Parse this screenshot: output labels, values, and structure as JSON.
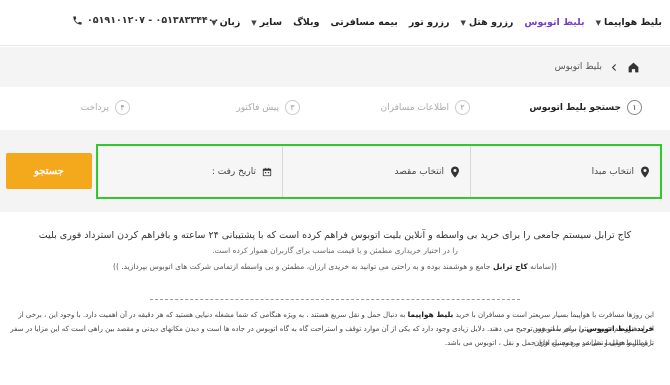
{
  "nav": {
    "items": [
      {
        "label": "بلیط هواپیما",
        "caret": true,
        "active": false
      },
      {
        "label": "بلیط اتوبوس",
        "caret": false,
        "active": true
      },
      {
        "label": "رزرو هتل",
        "caret": true,
        "active": false
      },
      {
        "label": "رزرو تور",
        "caret": false,
        "active": false
      },
      {
        "label": "بیمه مسافرتی",
        "caret": false,
        "active": false
      },
      {
        "label": "وبلاگ",
        "caret": false,
        "active": false
      },
      {
        "label": "سایر",
        "caret": true,
        "active": false
      },
      {
        "label": "زبان",
        "caret": true,
        "active": false
      }
    ],
    "phone": "۰۵۱۹۱۰۱۲۰۷ - ۰۵۱۳۸۳۳۴۴۰۰",
    "accent": "#7a3fc4"
  },
  "breadcrumb": {
    "current": "بلیط اتوبوس",
    "home_icon": "home-icon",
    "separator": "chevron-left-icon"
  },
  "steps": [
    {
      "num": "۱",
      "label": "جستجو بلیط اتوبوس",
      "active": true
    },
    {
      "num": "۲",
      "label": "اطلاعات مسافران",
      "active": false
    },
    {
      "num": "۳",
      "label": "پیش فاکتور",
      "active": false
    },
    {
      "num": "۴",
      "label": "پرداخت",
      "active": false
    }
  ],
  "search": {
    "origin": "انتخاب مبدا",
    "destination": "انتخاب مقصد",
    "date": "تاریخ رفت :",
    "button": "جستجو",
    "button_color": "#f4a81c",
    "highlight_color": "#2ec92a"
  },
  "content": {
    "line1": "کاج ترابل سیستم جامعی را برای خرید بی واسطه و آنلاین بلیت اتوبوس فراهم کرده است که با پشتیبانی ۲۴ ساعته و بافراهم کردن استرداد فوری بلیت",
    "line2": "را در اختیار خریداری مطمئن و با قیمت مناسب برای گاربران هموار کرده است.",
    "line3_pre": "((سامانه",
    "line3_bold": "کاج ترابل",
    "line3_post": "جامع و هوشمند بوده و به راحتی می توانید به خریدی ارزان، مطمئن و بی واسطه ازتمامی شرکت های اتوبوس بپردازید. ))",
    "para1_pre": "این روزها مسافرت با هواپیما بسیار سریعتر است و مسافران با خرید",
    "para1_bold": "بلیط هواپیما",
    "para1_post": "به دنبال حمل و نقل سریع هستند ، به ویژه هنگامی که شما مشغله دنیایی هستید که هر دقیقه در آن اهمیت دارد. با وجود این ، برخی از افراد هنوز هم شیوه سنتی سفر با اتوبوس و",
    "para2_bold": "خرید بلیط اتوبوس",
    "para2_post": "را برای سفر خود ترجیح می دهند. دلایل زیادی وجود دارد که یکی از آن موارد توقف و استراحت گاه به گاه اتوبوس در جاده ها است و دیدن مکانهای دیدنی و مقصد بین راهی است که این مزایا در سفر با قطار و هواپیما نمیباشد و همچنین ارزان",
    "para3": "ترین بلیط حمل و نقل در بین وسیله های حمل و نقل ، اتوبوس می باشد."
  }
}
